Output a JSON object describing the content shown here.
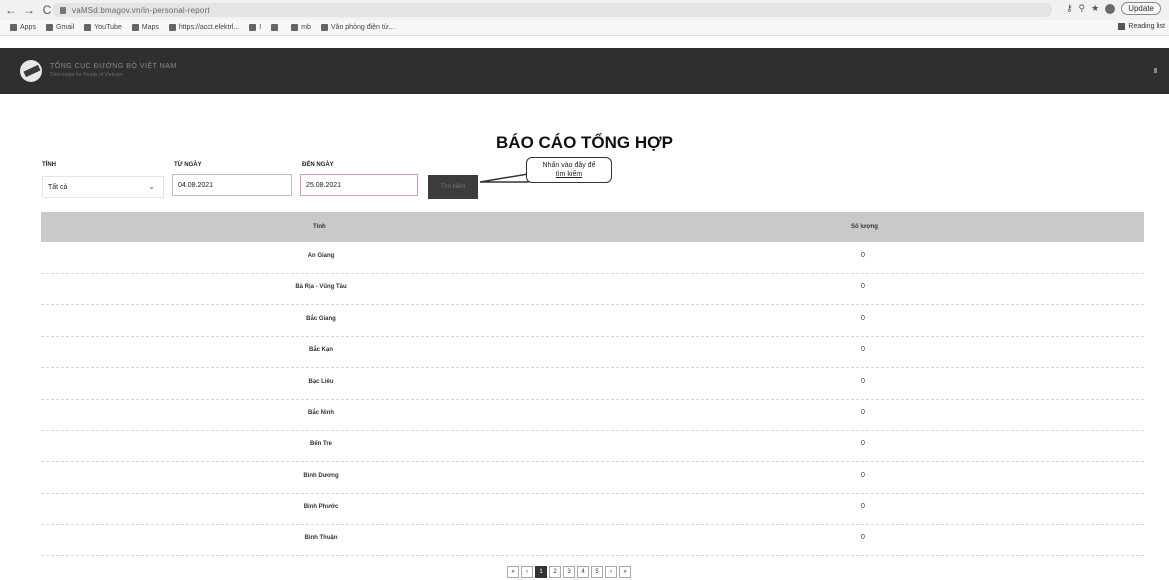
{
  "browser": {
    "url": "vaMSd.bmagov.vn/in-personal-report",
    "update_label": "Update",
    "bookmarks": [
      "Apps",
      "Gmail",
      "YouTube",
      "Maps",
      "https://acct.elektrl...",
      "I",
      "",
      "mb",
      "Văn phòng điện tử..."
    ],
    "reading_list": "Reading list"
  },
  "header": {
    "org_name": "TỔNG CỤC ĐƯỜNG BỘ VIỆT NAM",
    "org_sub": "Directorate for Roads of Vietnam",
    "nav": [
      "",
      ""
    ]
  },
  "page": {
    "title": "BÁO CÁO TỔNG HỢP"
  },
  "filters": {
    "province_label": "TỈNH",
    "province_value": "Tất cả",
    "from_label": "TỪ NGÀY",
    "from_value": "04.08.2021",
    "to_label": "ĐẾN NGÀY",
    "to_value": "25.08.2021",
    "search_label": "Tìm kiếm",
    "callout_line1": "Nhấn vào đây để",
    "callout_line2": "tìm kiếm"
  },
  "table": {
    "col_province": "Tỉnh",
    "col_count": "Số lượng",
    "rows": [
      {
        "province": "An Giang",
        "count": "0"
      },
      {
        "province": "Bà Rịa - Vũng Tàu",
        "count": "0"
      },
      {
        "province": "Bắc Giang",
        "count": "0"
      },
      {
        "province": "Bắc Kạn",
        "count": "0"
      },
      {
        "province": "Bạc Liêu",
        "count": "0"
      },
      {
        "province": "Bắc Ninh",
        "count": "0"
      },
      {
        "province": "Bến Tre",
        "count": "0"
      },
      {
        "province": "Bình Dương",
        "count": "0"
      },
      {
        "province": "Bình Phước",
        "count": "0"
      },
      {
        "province": "Bình Thuận",
        "count": "0"
      }
    ]
  },
  "pagination": [
    "«",
    "‹",
    "1",
    "2",
    "3",
    "4",
    "5",
    "›",
    "»"
  ]
}
